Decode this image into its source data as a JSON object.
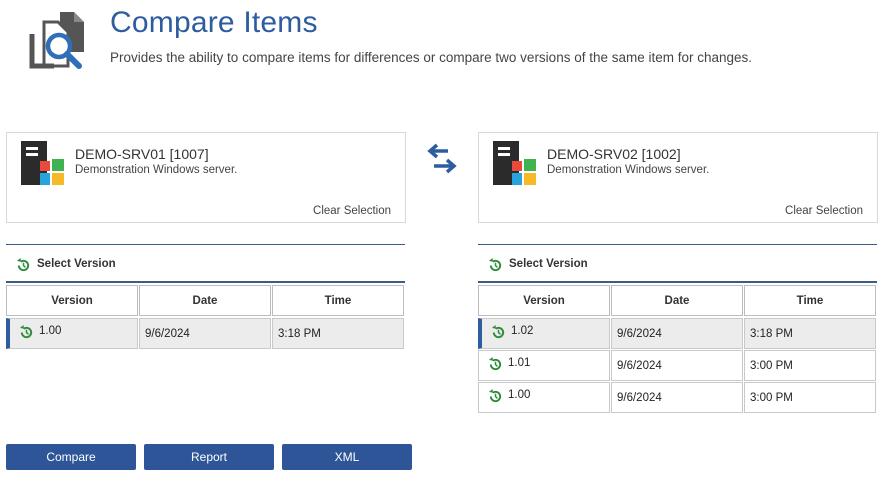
{
  "header": {
    "title": "Compare Items",
    "subtitle": "Provides the ability to compare items for differences or compare two versions of the same item for changes.",
    "icon": "compare-search-icon",
    "accent_color": "#2d5d9f"
  },
  "left_item": {
    "name": "DEMO-SRV01 [1007]",
    "description": "Demonstration Windows server.",
    "clear_label": "Clear Selection",
    "icon": "windows-server-icon"
  },
  "right_item": {
    "name": "DEMO-SRV02 [1002]",
    "description": "Demonstration Windows server.",
    "clear_label": "Clear Selection",
    "icon": "windows-server-icon"
  },
  "swap_icon": "swap-arrows-icon",
  "left_versions": {
    "section_label": "Select Version",
    "columns": [
      "Version",
      "Date",
      "Time"
    ],
    "rows": [
      {
        "version": "1.00",
        "date": "9/6/2024",
        "time": "3:18 PM",
        "selected": true
      }
    ]
  },
  "right_versions": {
    "section_label": "Select Version",
    "columns": [
      "Version",
      "Date",
      "Time"
    ],
    "rows": [
      {
        "version": "1.02",
        "date": "9/6/2024",
        "time": "3:18 PM",
        "selected": true
      },
      {
        "version": "1.01",
        "date": "9/6/2024",
        "time": "3:00 PM",
        "selected": false
      },
      {
        "version": "1.00",
        "date": "9/6/2024",
        "time": "3:00 PM",
        "selected": false
      }
    ]
  },
  "buttons": {
    "compare": "Compare",
    "report": "Report",
    "xml": "XML",
    "color": "#2d5597"
  }
}
